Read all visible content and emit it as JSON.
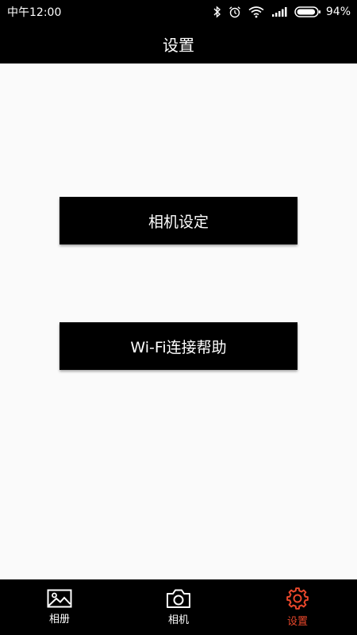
{
  "status_bar": {
    "time": "中午12:00",
    "battery_percent": "94%",
    "battery_level": 0.94,
    "icons": [
      "bluetooth-icon",
      "alarm-icon",
      "wifi-icon",
      "signal-icon",
      "battery-icon"
    ]
  },
  "header": {
    "title": "设置"
  },
  "main": {
    "buttons": [
      {
        "label": "相机设定"
      },
      {
        "label": "Wi-Fi连接帮助"
      }
    ]
  },
  "bottom_nav": {
    "items": [
      {
        "label": "相册",
        "icon": "gallery-icon",
        "active": false
      },
      {
        "label": "相机",
        "icon": "camera-icon",
        "active": false
      },
      {
        "label": "设置",
        "icon": "gear-icon",
        "active": true
      }
    ],
    "active_color": "#e8472b",
    "inactive_color": "#ffffff"
  },
  "colors": {
    "bar_background": "#000000",
    "content_background": "#fafafa",
    "button_background": "#000000",
    "button_text": "#ffffff"
  }
}
